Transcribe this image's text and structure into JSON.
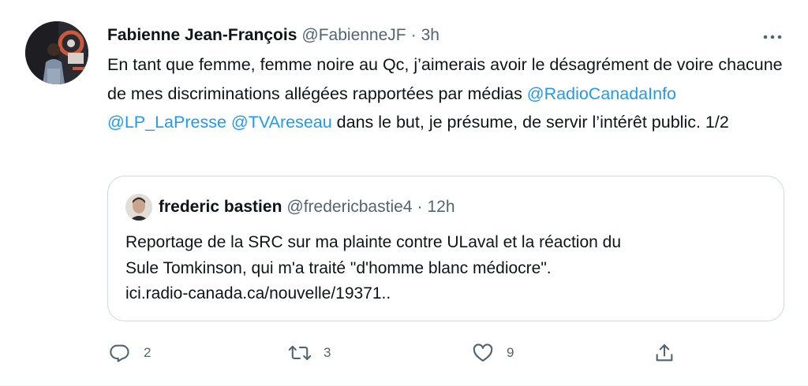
{
  "tweet": {
    "author_name": "Fabienne Jean-François",
    "author_handle": "@FabienneJF",
    "separator": "·",
    "time": "3h",
    "text": {
      "part1": "En tant que femme, femme noire au Qc, j’aimerais avoir le désagrément de voire chacune de mes discriminations allégées rapportées par médias ",
      "mention1": "@RadioCanadaInfo",
      "mention2": "@LP_LaPresse",
      "mention3": "@TVAreseau",
      "part2": " dans le but, je présume, de servir l’intérêt public. 1/2"
    }
  },
  "quoted_tweet": {
    "author_name": "frederic bastien",
    "author_handle": "@fredericbastie4",
    "separator": "·",
    "time": "12h",
    "line1": "Reportage de la SRC sur ma plainte contre ULaval et la réaction du",
    "line2": "Sule Tomkinson, qui m'a traité \"d'homme blanc médiocre\".",
    "link": "ici.radio-canada.ca/nouvelle/19371.."
  },
  "actions": {
    "reply_count": "2",
    "retweet_count": "3",
    "like_count": "9",
    "share_count": ""
  },
  "colors": {
    "text": "#0f1419",
    "secondary": "#536471",
    "link": "#1d9bf0",
    "border": "#cfd9de"
  },
  "icons": [
    "more-icon",
    "reply-icon",
    "retweet-icon",
    "like-icon",
    "share-icon"
  ]
}
